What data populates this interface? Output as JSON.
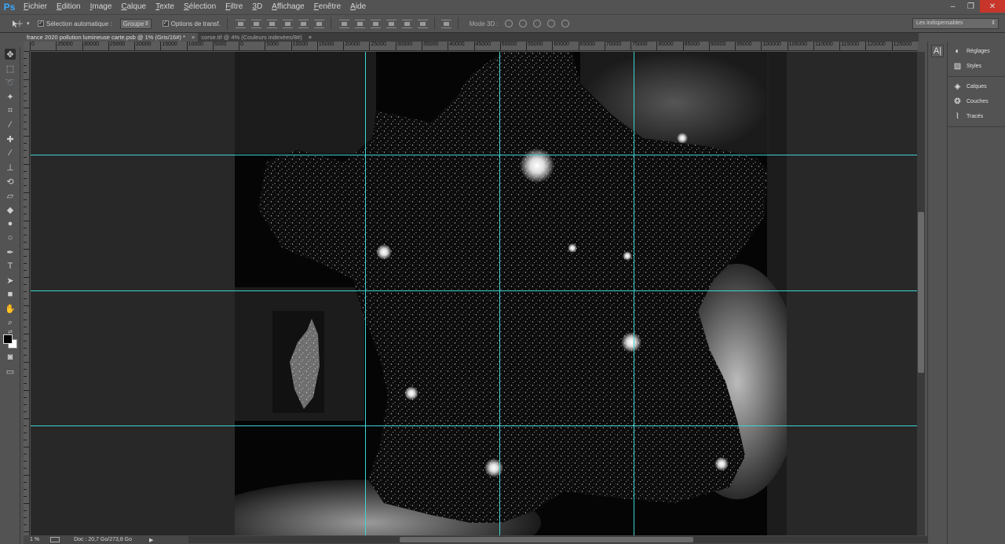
{
  "app": {
    "logo": "Ps"
  },
  "menu": [
    "Fichier",
    "Edition",
    "Image",
    "Calque",
    "Texte",
    "Sélection",
    "Filtre",
    "3D",
    "Affichage",
    "Fenêtre",
    "Aide"
  ],
  "window_controls": {
    "minimize": "–",
    "restore": "❐",
    "close": "✕"
  },
  "options_bar": {
    "tool_icon": "move-tool-icon",
    "auto_select_label": "Sélection automatique :",
    "auto_select_checked": true,
    "auto_select_target": "Groupe",
    "transform_options_label": "Options de transf.",
    "transform_options_checked": true,
    "mode3d_label": "Mode 3D :",
    "workspace": "Les indispensables"
  },
  "tabs": [
    {
      "label": "france 2020 pollution lumineuse carte.psb @ 1% (Gris/16#) *",
      "active": true,
      "close": "×"
    },
    {
      "label": "corse.tif @ 4% (Couleurs indexées/8#)",
      "active": false,
      "close": "×"
    }
  ],
  "ruler": {
    "h_labels": [
      "0",
      "25000",
      "30000",
      "25000",
      "20000",
      "15000",
      "10000",
      "5000",
      "0",
      "5000",
      "10000",
      "15000",
      "20000",
      "25000",
      "30000",
      "35000",
      "40000",
      "45000",
      "50000",
      "55000",
      "60000",
      "65000",
      "70000",
      "75000",
      "80000",
      "85000",
      "90000",
      "95000",
      "100000",
      "105000",
      "110000",
      "115000",
      "120000",
      "125000"
    ]
  },
  "status": {
    "zoom": "1 %",
    "doc_info": "Doc : 20,7 Go/273,8 Go",
    "arrow": "▶"
  },
  "panels": {
    "group1": [
      {
        "label": "Réglages",
        "icon": "adjustments-icon"
      },
      {
        "label": "Styles",
        "icon": "styles-icon"
      }
    ],
    "group2": [
      {
        "label": "Calques",
        "icon": "layers-icon"
      },
      {
        "label": "Couches",
        "icon": "channels-icon"
      },
      {
        "label": "Tracés",
        "icon": "paths-icon"
      }
    ]
  },
  "colors": {
    "guide": "#3fd3d3",
    "accent_logo": "#3aa8ff",
    "foreground_color": "#000000",
    "background_color": "#ffffff"
  }
}
